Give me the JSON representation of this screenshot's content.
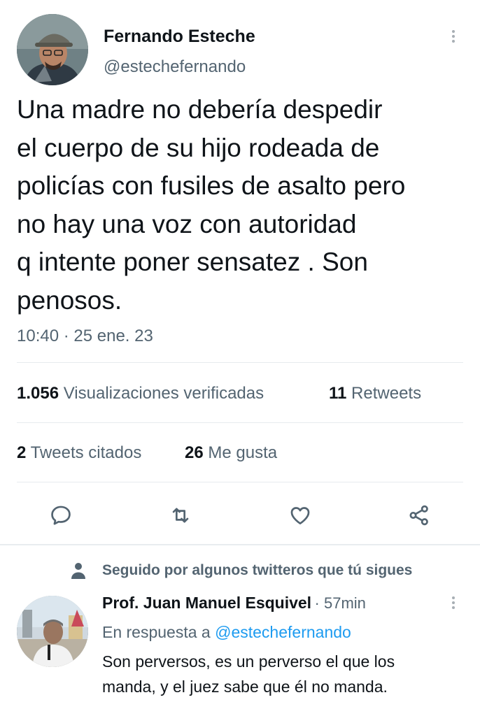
{
  "tweet": {
    "author_name": "Fernando Esteche",
    "author_handle": "@estechefernando",
    "text": "Una madre no debería despedir\nel cuerpo de su hijo rodeada de\npolicías con fusiles de asalto pero\nno hay una voz con autoridad\nq intente poner sensatez . Son\npenosos.",
    "timestamp": "10:40 · 25 ene. 23",
    "avatar_icon": "person-with-cap-avatar",
    "more_icon": "vertical-ellipsis-icon"
  },
  "stats": {
    "views_count": "1.056",
    "views_label": "Visualizaciones verificadas",
    "retweets_count": "11",
    "retweets_label": "Retweets",
    "quotes_count": "2",
    "quotes_label": "Tweets citados",
    "likes_count": "26",
    "likes_label": "Me gusta"
  },
  "actions": [
    "reply-icon",
    "retweet-icon",
    "like-icon",
    "share-icon"
  ],
  "colors": {
    "text": "#0f1419",
    "secondary": "#536471",
    "accent": "#1d9bf0",
    "divider": "#e6ebee"
  },
  "reply": {
    "social_context": "Seguido por algunos twitteros que tú sigues",
    "author_name": "Prof. Juan Manuel Esquivel",
    "time": "· 57min",
    "in_reply_prefix": "En respuesta a",
    "in_reply_handle": "@estechefernando",
    "text": "Son perversos, es un perverso el que los\nmanda, y el juez sabe que él no manda."
  }
}
